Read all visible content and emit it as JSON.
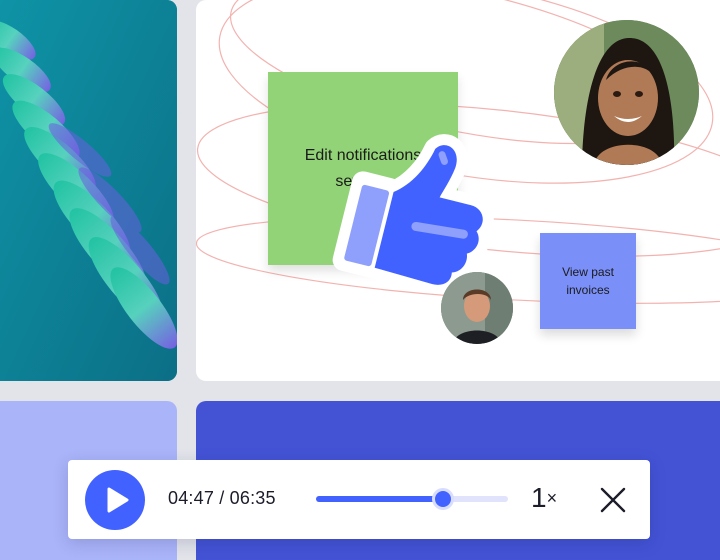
{
  "board": {
    "sticky_green_text": "Edit notifications settings",
    "sticky_purple_text": "View past invoices"
  },
  "player": {
    "elapsed": "04:47",
    "separator": " / ",
    "duration": "06:35",
    "progress_fraction": 0.66,
    "speed_value": "1",
    "speed_suffix": "×"
  },
  "colors": {
    "accent": "#4262ff",
    "sticky_green": "#93d377",
    "sticky_purple": "#7a8ff7",
    "panel_blue": "#4353d4",
    "panel_lavender": "#aab4f8",
    "art_teal": "#0d8a9e"
  },
  "icons": [
    "play-icon",
    "close-icon",
    "thumbs-up-icon"
  ]
}
